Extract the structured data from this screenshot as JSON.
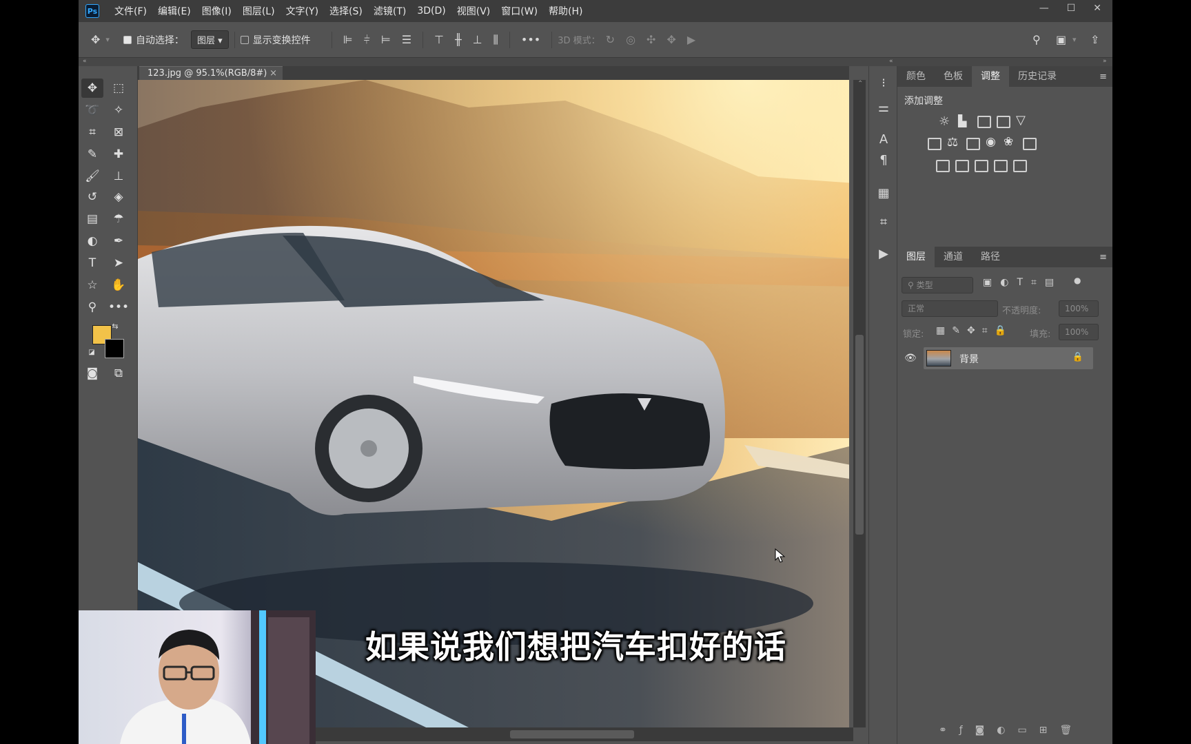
{
  "app": {
    "logo": "Ps",
    "menu": [
      "文件(F)",
      "编辑(E)",
      "图像(I)",
      "图层(L)",
      "文字(Y)",
      "选择(S)",
      "滤镜(T)",
      "3D(D)",
      "视图(V)",
      "窗口(W)",
      "帮助(H)"
    ],
    "window_controls": [
      "—",
      "☐",
      "✕"
    ]
  },
  "options": {
    "auto_select_label": "自动选择：",
    "auto_select_target": "图层",
    "show_transform_label": "显示变换控件",
    "mode_3d_label": "3D 模式：",
    "more_label": "•••"
  },
  "document": {
    "tab_label": "123.jpg @ 95.1%(RGB/8#)",
    "close_glyph": "×"
  },
  "panels": {
    "top_tabs": [
      "颜色",
      "色板",
      "调整",
      "历史记录"
    ],
    "active_top_tab": "调整",
    "adjust_title": "添加调整",
    "layer_tabs": [
      "图层",
      "通道",
      "路径"
    ],
    "active_layer_tab": "图层",
    "filter_placeholder": "类型",
    "blend_mode": "正常",
    "opacity_label": "不透明度:",
    "opacity_value": "100%",
    "lock_label": "锁定:",
    "fill_label": "填充:",
    "fill_value": "100%",
    "layers": [
      {
        "name": "背景",
        "visible": true,
        "locked": true
      }
    ]
  },
  "colors": {
    "foreground": "#f2c249",
    "background": "#000000",
    "accent": "#31a8ff"
  },
  "subtitle": "如果说我们想把汽车扣好的话"
}
